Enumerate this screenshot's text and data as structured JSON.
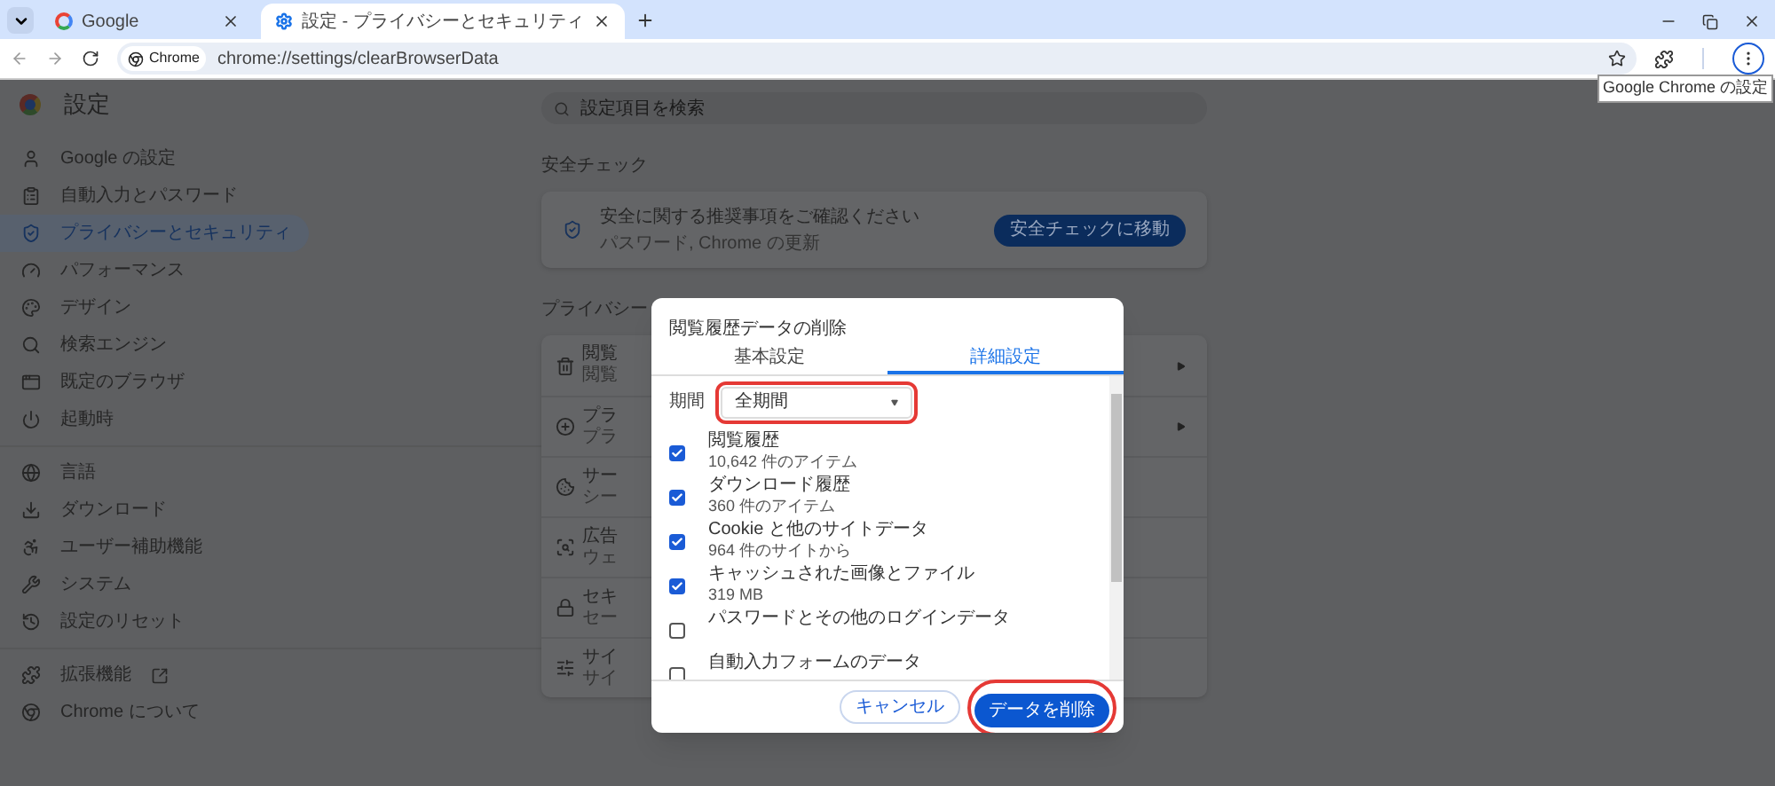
{
  "tabs": [
    {
      "title": "Google",
      "selected": false
    },
    {
      "title": "設定 - プライバシーとセキュリティ",
      "selected": true
    }
  ],
  "address_bar": {
    "chip": "Chrome",
    "url": "chrome://settings/clearBrowserData"
  },
  "tooltip": "Google Chrome の設定",
  "settings": {
    "title": "設定",
    "search_placeholder": "設定項目を検索",
    "sidebar": {
      "groups": [
        [
          {
            "label": "Google の設定",
            "selected": false
          },
          {
            "label": "自動入力とパスワード",
            "selected": false
          },
          {
            "label": "プライバシーとセキュリティ",
            "selected": true
          },
          {
            "label": "パフォーマンス",
            "selected": false
          },
          {
            "label": "デザイン",
            "selected": false
          },
          {
            "label": "検索エンジン",
            "selected": false
          },
          {
            "label": "既定のブラウザ",
            "selected": false
          },
          {
            "label": "起動時",
            "selected": false
          }
        ],
        [
          {
            "label": "言語",
            "selected": false
          },
          {
            "label": "ダウンロード",
            "selected": false
          },
          {
            "label": "ユーザー補助機能",
            "selected": false
          },
          {
            "label": "システム",
            "selected": false
          },
          {
            "label": "設定のリセット",
            "selected": false
          }
        ],
        [
          {
            "label": "拡張機能",
            "selected": false
          },
          {
            "label": "Chrome について",
            "selected": false
          }
        ]
      ]
    },
    "safety_check": {
      "heading": "安全チェック",
      "line_1": "安全に関する推奨事項をご確認ください",
      "line_2": "パスワード, Chrome の更新",
      "button": "安全チェックに移動"
    },
    "privacy": {
      "heading": "プライバシー",
      "rows": [
        {
          "line_1": "閲覧",
          "line_2": "閲覧"
        },
        {
          "line_1": "プラ",
          "line_2": "プラ"
        },
        {
          "line_1": "サー",
          "line_2": "シー"
        },
        {
          "line_1": "広告",
          "line_2": "ウェ"
        },
        {
          "line_1": "セキ",
          "line_2": "セー"
        },
        {
          "line_1": "サイ",
          "line_2": "サイ"
        }
      ]
    }
  },
  "dialog": {
    "title": "閲覧履歴データの削除",
    "tabs": [
      {
        "label": "基本設定",
        "selected": false
      },
      {
        "label": "詳細設定",
        "selected": true
      }
    ],
    "period_label": "期間",
    "period_value": "全期間",
    "items": [
      {
        "label": "閲覧履歴",
        "detail": "10,642 件のアイテム",
        "checked": true
      },
      {
        "label": "ダウンロード履歴",
        "detail": "360 件のアイテム",
        "checked": true
      },
      {
        "label": "Cookie と他のサイトデータ",
        "detail": "964 件のサイトから",
        "checked": true
      },
      {
        "label": "キャッシュされた画像とファイル",
        "detail": "319 MB",
        "checked": true
      },
      {
        "label": "パスワードとその他のログインデータ",
        "checked": false
      },
      {
        "label": "自動入力フォームのデータ",
        "checked": false
      }
    ],
    "cancel": "キャンセル",
    "confirm": "データを削除"
  }
}
